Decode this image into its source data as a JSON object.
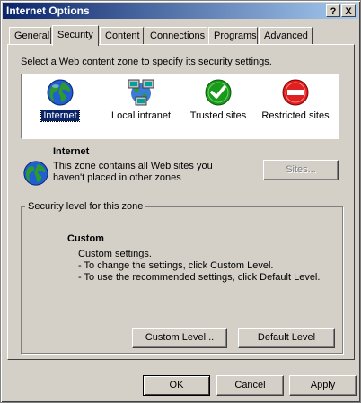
{
  "window": {
    "title": "Internet Options",
    "help_glyph": "?",
    "close_glyph": "X"
  },
  "tabs": [
    {
      "label": "General"
    },
    {
      "label": "Security"
    },
    {
      "label": "Content"
    },
    {
      "label": "Connections"
    },
    {
      "label": "Programs"
    },
    {
      "label": "Advanced"
    }
  ],
  "active_tab": "Security",
  "zone_prompt": "Select a Web content zone to specify its security settings.",
  "zones": [
    {
      "label": "Internet",
      "icon": "globe-icon"
    },
    {
      "label": "Local intranet",
      "icon": "network-computers-icon"
    },
    {
      "label": "Trusted sites",
      "icon": "green-check-icon"
    },
    {
      "label": "Restricted sites",
      "icon": "red-no-entry-icon"
    }
  ],
  "selected_zone": "Internet",
  "zone_info": {
    "title": "Internet",
    "description_line1": "This zone contains all Web sites you",
    "description_line2": "haven't placed in other zones",
    "sites_button": "Sites..."
  },
  "security_level": {
    "group_label": "Security level for this zone",
    "level_title": "Custom",
    "line1": "Custom settings.",
    "line2": "- To change the settings, click Custom Level.",
    "line3": "- To use the recommended settings, click Default Level.",
    "custom_button": "Custom Level...",
    "default_button": "Default Level"
  },
  "footer": {
    "ok": "OK",
    "cancel": "Cancel",
    "apply": "Apply"
  },
  "colors": {
    "titlebar_start": "#0a246a",
    "titlebar_end": "#a6caf0",
    "face": "#d4d0c8",
    "selection": "#0a246a"
  }
}
